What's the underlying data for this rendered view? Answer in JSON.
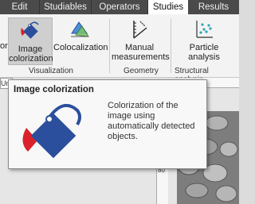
{
  "tabs": [
    {
      "label": "Edit",
      "active": false
    },
    {
      "label": "Studiables",
      "active": false
    },
    {
      "label": "Operators",
      "active": false
    },
    {
      "label": "Studies",
      "active": true
    },
    {
      "label": "Results",
      "active": false
    }
  ],
  "ribbon": {
    "partial_left_label": "or",
    "buttons": {
      "image_colorization": {
        "line1": "Image",
        "line2": "colorization",
        "icon": "paint-bucket-icon"
      },
      "colocalization": {
        "label": "Colocalization",
        "icon": "colocalization-icon"
      },
      "manual_measurements": {
        "line1": "Manual",
        "line2": "measurements",
        "icon": "ruler-angle-icon"
      },
      "particle_analysis": {
        "line1": "Particle",
        "line2": "analysis",
        "icon": "particle-chart-icon"
      }
    },
    "groups": {
      "visualization": "Visualization",
      "geometry": "Geometry",
      "structural_analysis": "Structural analysis"
    }
  },
  "document": {
    "tab_partial": "Un",
    "ruler_tick": "80"
  },
  "tooltip": {
    "title": "Image colorization",
    "description": "Colorization of the image using automatically detected objects.",
    "icon": "paint-bucket-icon"
  },
  "colors": {
    "tab_bar": "#4a4a4a",
    "bucket_blue": "#2b4f9c",
    "paint_red": "#d9222a"
  }
}
